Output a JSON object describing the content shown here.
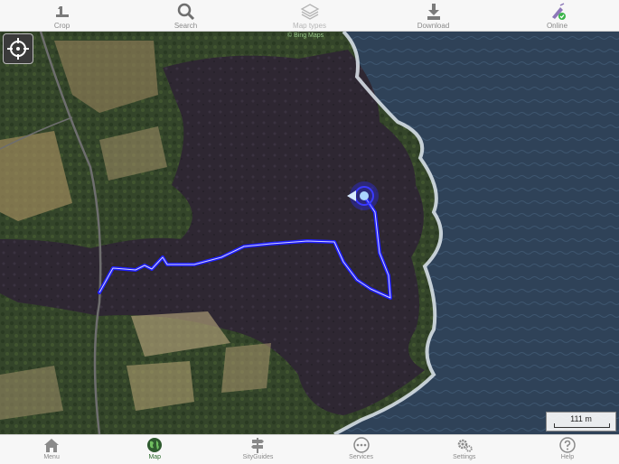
{
  "toolbar": {
    "items": [
      {
        "label": "Crop",
        "icon": "crop-icon"
      },
      {
        "label": "Search",
        "icon": "search-icon"
      },
      {
        "label": "Map types",
        "icon": "layers-icon"
      },
      {
        "label": "Download",
        "icon": "download-icon"
      },
      {
        "label": "Online",
        "icon": "online-icon"
      }
    ]
  },
  "map": {
    "attribution": "© Bing Maps"
  },
  "scale": {
    "label": "111 m"
  },
  "tabbar": {
    "items": [
      {
        "label": "Menu",
        "icon": "home-icon"
      },
      {
        "label": "Map",
        "icon": "globe-icon"
      },
      {
        "label": "SityGuides",
        "icon": "signpost-icon"
      },
      {
        "label": "Services",
        "icon": "more-icon"
      },
      {
        "label": "Settings",
        "icon": "gear-icon"
      },
      {
        "label": "Help",
        "icon": "help-icon"
      }
    ],
    "active": "Map"
  },
  "colors": {
    "track": "#1f1fff",
    "ocean": "#2b3d52",
    "lava": "#2c2530",
    "vegetation": "#3a4a2a"
  }
}
